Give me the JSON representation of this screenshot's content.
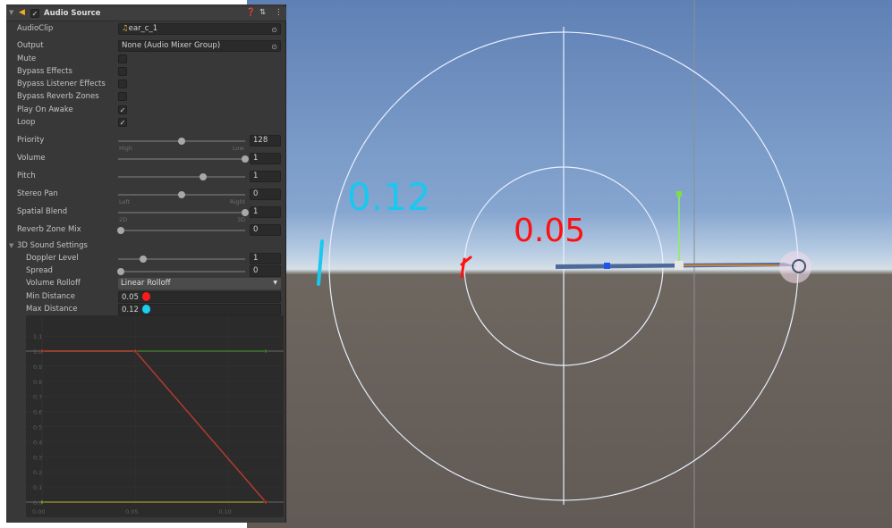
{
  "component": {
    "title": "Audio Source",
    "enabled": true,
    "icons": [
      "speaker-icon",
      "help-icon",
      "presets-icon",
      "more-icon"
    ]
  },
  "fields": {
    "audio_clip": {
      "label": "AudioClip",
      "value": "ear_c_1"
    },
    "output": {
      "label": "Output",
      "value": "None (Audio Mixer Group)"
    },
    "mute": {
      "label": "Mute",
      "checked": false
    },
    "bypass_effects": {
      "label": "Bypass Effects",
      "checked": false
    },
    "bypass_listener": {
      "label": "Bypass Listener Effects",
      "checked": false
    },
    "bypass_reverb": {
      "label": "Bypass Reverb Zones",
      "checked": false
    },
    "play_on_awake": {
      "label": "Play On Awake",
      "checked": true
    },
    "loop": {
      "label": "Loop",
      "checked": true
    },
    "check_glyph": "✓"
  },
  "sliders": {
    "priority": {
      "label": "Priority",
      "value": "128",
      "fraction": 0.5,
      "min_caption": "High",
      "max_caption": "Low"
    },
    "volume": {
      "label": "Volume",
      "value": "1",
      "fraction": 1
    },
    "pitch": {
      "label": "Pitch",
      "value": "1",
      "fraction": 0.67
    },
    "stereo_pan": {
      "label": "Stereo Pan",
      "value": "0",
      "fraction": 0.5,
      "min_caption": "Left",
      "max_caption": "Right"
    },
    "spatial_blend": {
      "label": "Spatial Blend",
      "value": "1",
      "fraction": 1,
      "min_caption": "2D",
      "max_caption": "3D"
    },
    "reverb_mix": {
      "label": "Reverb Zone Mix",
      "value": "0",
      "fraction": 0
    }
  },
  "sound3d": {
    "title": "3D Sound Settings",
    "doppler": {
      "label": "Doppler Level",
      "value": "1",
      "fraction": 0.2
    },
    "spread": {
      "label": "Spread",
      "value": "0",
      "fraction": 0
    },
    "rolloff": {
      "label": "Volume Rolloff",
      "value": "Linear Rolloff"
    },
    "min_distance": {
      "label": "Min Distance",
      "value": "0.05",
      "marker_color": "#ff1a1a"
    },
    "max_distance": {
      "label": "Max Distance",
      "value": "0.12",
      "marker_color": "#1ad0f0"
    }
  },
  "chart_data": {
    "type": "line",
    "xlim": [
      0,
      0.12
    ],
    "ylim": [
      0,
      1.1
    ],
    "x_ticks": [
      "0.00",
      "0.05",
      "0.10"
    ],
    "y_ticks": [
      "0.0",
      "0.1",
      "0.2",
      "0.3",
      "0.4",
      "0.5",
      "0.6",
      "0.7",
      "0.8",
      "0.9",
      "1.0",
      "1.1"
    ],
    "series": [
      {
        "color": "#b33a2e",
        "points": [
          [
            0,
            1
          ],
          [
            0.05,
            1
          ],
          [
            0.12,
            0
          ]
        ]
      },
      {
        "color": "#3f7a2f",
        "points": [
          [
            0,
            1
          ],
          [
            0.12,
            1
          ]
        ]
      },
      {
        "color": "#8a8a2a",
        "points": [
          [
            0,
            0
          ],
          [
            0.12,
            0
          ]
        ]
      }
    ]
  },
  "scene": {
    "annotations": [
      {
        "text": "0.12",
        "color": "#19c8f0"
      },
      {
        "text": "0.05",
        "color": "#ff1010"
      }
    ],
    "min_circle_color": "#e8f0ff",
    "max_circle_color": "#e8f0ff"
  }
}
